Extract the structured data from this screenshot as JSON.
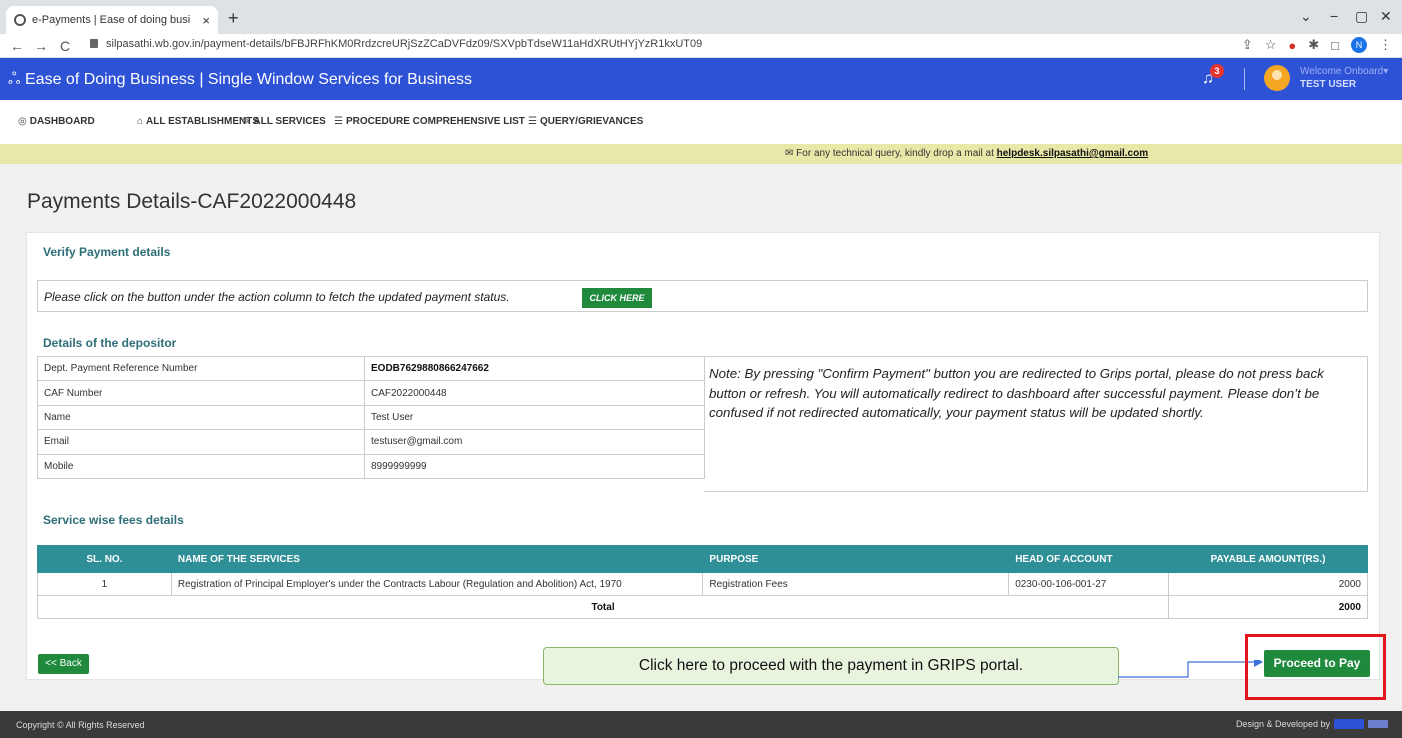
{
  "browser": {
    "tab_title": "e-Payments | Ease of doing busi",
    "tab_close": "×",
    "new_tab": "+",
    "url": "silpasathi.wb.gov.in/payment-details/bFBJRFhKM0RrdzcreURjSzZCaDVFdz09/SXVpbTdseW11aHdXRUtHYjYzR1kxUT09",
    "back": "←",
    "forward": "→",
    "reload": "C",
    "profile_initial": "N",
    "window_controls": [
      "⌄",
      "−",
      "▢",
      "✕"
    ],
    "ext_icons": [
      "⇪",
      "☆",
      "●",
      "✱",
      "□",
      "⋮"
    ]
  },
  "header": {
    "title": "Ease of Doing Business | Single Window Services for Business",
    "logo_icon": "network-icon",
    "logo_glyph": "ஃ",
    "bell_glyph": "♫",
    "notification_count": "3",
    "welcome": "Welcome Onboard▾",
    "user": "TEST USER"
  },
  "menu": {
    "items": [
      {
        "label": "DASHBOARD",
        "icon": "dashboard-icon",
        "glyph": "◎"
      },
      {
        "label": "ALL ESTABLISHMENTS",
        "icon": "building-icon",
        "glyph": "⌂"
      },
      {
        "label": "ALL SERVICES",
        "icon": "wrench-icon",
        "glyph": "✎"
      },
      {
        "label": "PROCEDURE COMPREHENSIVE LIST",
        "icon": "list-icon",
        "glyph": "☰"
      },
      {
        "label": "QUERY/GRIEVANCES",
        "icon": "list-icon",
        "glyph": "☰"
      }
    ]
  },
  "notice": {
    "icon_glyph": "✉",
    "text": "For any technical query, kindly drop a mail at ",
    "email": "helpdesk.silpasathi@gmail.com"
  },
  "page": {
    "title": "Payments Details-CAF2022000448",
    "verify_heading": "Verify Payment details",
    "verify_text": "Please click on the button under the action column to fetch the updated payment status.",
    "click_here": "CLICK HERE",
    "depositor_heading": "Details of the depositor",
    "depositor": [
      {
        "label": "Dept. Payment Reference Number",
        "value": "EODB7629880866247662"
      },
      {
        "label": "CAF Number",
        "value": "CAF2022000448"
      },
      {
        "label": "Name",
        "value": "Test User"
      },
      {
        "label": "Email",
        "value": "testuser@gmail.com"
      },
      {
        "label": "Mobile",
        "value": "8999999999"
      }
    ],
    "note": "Note: By pressing \"Confirm Payment\" button you are redirected to Grips portal, please do not press back button or refresh. You will automatically redirect to dashboard after successful payment. Please don’t be confused if not redirected automatically, your payment status will be updated shortly.",
    "fees_heading": "Service wise fees details",
    "fees_columns": [
      "SL. NO.",
      "NAME OF THE SERVICES",
      "PURPOSE",
      "HEAD OF ACCOUNT",
      "PAYABLE AMOUNT(RS.)"
    ],
    "fees_rows": [
      {
        "sl": "1",
        "service": "Registration of Principal Employer's under the Contracts Labour (Regulation and Abolition) Act, 1970",
        "purpose": "Registration Fees",
        "head": "0230-00-106-001-27",
        "amount": "2000"
      }
    ],
    "total_label": "Total",
    "total_amount": "2000",
    "back_button": "<< Back",
    "pay_button": "Proceed to Pay",
    "callout": "Click here to proceed with the payment in GRIPS portal."
  },
  "footer": {
    "copyright": "Copyright © All Rights Reserved",
    "developed_by": "Design & Developed by"
  },
  "colors": {
    "header_blue": "#2d52d6",
    "teal_heading": "#2d6e78",
    "table_header": "#2e8f96",
    "button_green": "#1f8a3c",
    "highlight_red": "#e3141b",
    "callout_green": "#e9f4df"
  }
}
